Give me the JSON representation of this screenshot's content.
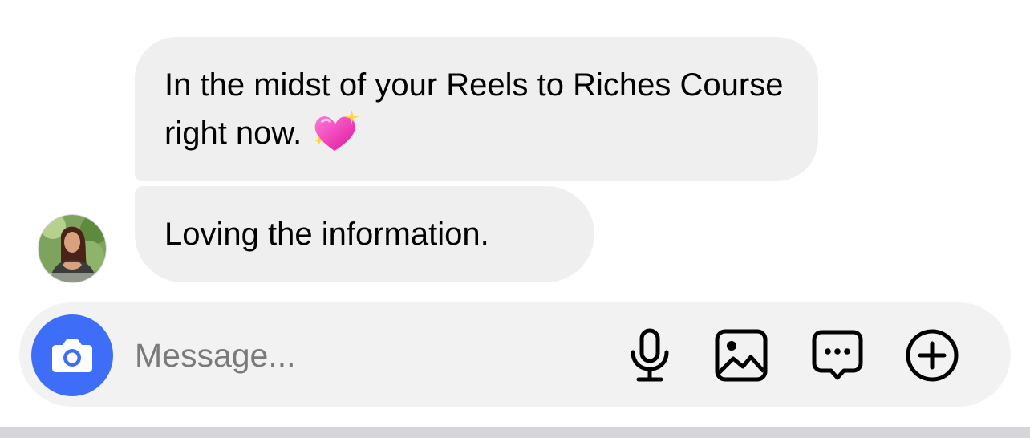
{
  "conversation": {
    "messages": [
      {
        "text": "In the midst of your Reels to Riches Course right now.",
        "emoji": "sparkling-heart"
      },
      {
        "text": "Loving the information."
      }
    ],
    "sender_avatar": "avatar-photo"
  },
  "composer": {
    "placeholder": "Message...",
    "value": "",
    "camera_icon": "camera-icon",
    "icons": [
      "microphone-icon",
      "gallery-icon",
      "sticker-icon",
      "add-icon"
    ]
  },
  "colors": {
    "bubble_background": "#efefef",
    "composer_background": "#f2f2f2",
    "camera_button": "#3e6ef8",
    "placeholder_text": "#7a7a7a",
    "bottom_bar": "#d5d6da"
  }
}
